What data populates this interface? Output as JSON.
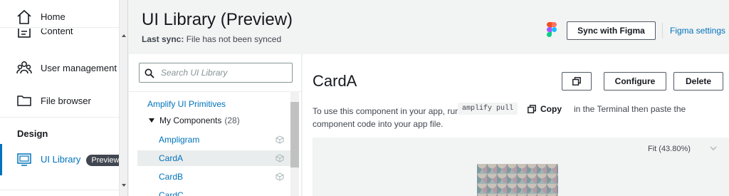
{
  "nav": {
    "home": "Home",
    "content": "Content",
    "user_management": "User management",
    "file_browser": "File browser",
    "section_design": "Design",
    "ui_library": "UI Library",
    "ui_library_badge": "Preview"
  },
  "header": {
    "title": "UI Library (Preview)",
    "last_sync_label": "Last sync:",
    "last_sync_value": " File has not been synced",
    "sync_button": "Sync with Figma",
    "figma_settings": "Figma settings"
  },
  "library": {
    "search_placeholder": "Search UI Library",
    "primitives_link": "Amplify UI Primitives",
    "group_label": "My Components",
    "group_count": "(28)",
    "items": [
      {
        "label": "Ampligram"
      },
      {
        "label": "CardA"
      },
      {
        "label": "CardB"
      },
      {
        "label": "CardC"
      }
    ]
  },
  "main": {
    "component_title": "CardA",
    "configure_button": "Configure",
    "delete_button": "Delete",
    "instruction_start": "To use this component in your app, run",
    "command": "amplify pull",
    "copy_label": "Copy",
    "instruction_rest": "in the Terminal then paste the",
    "instruction_line2": "component code into your app file.",
    "zoom_label": "Fit (43.80%)"
  },
  "colors": {
    "link": "#0073bb",
    "active_bar": "#0073bb",
    "badge_bg": "#414750"
  }
}
